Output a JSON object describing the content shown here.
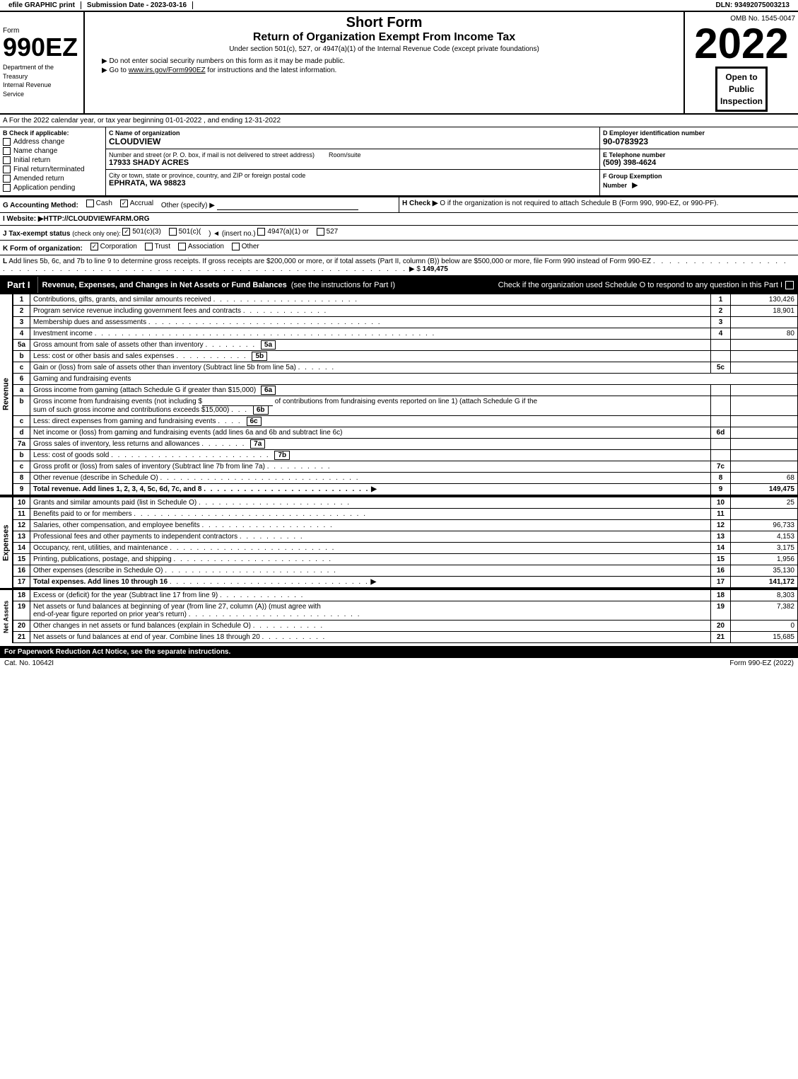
{
  "topbar": {
    "efile": "efile GRAPHIC print",
    "submission": "Submission Date - 2023-03-16",
    "dln": "DLN: 93492075003213"
  },
  "header": {
    "form_id": "990EZ",
    "form_label": "Form",
    "dept1": "Department of the",
    "dept2": "Treasury",
    "dept3": "Internal Revenue",
    "dept4": "Service",
    "title1": "Short Form",
    "title2": "Return of Organization Exempt From Income Tax",
    "subtitle": "Under section 501(c), 527, or 4947(a)(1) of the Internal Revenue Code (except private foundations)",
    "notice1": "▶ Do not enter social security numbers on this form as it may be made public.",
    "notice2": "▶ Go to ",
    "irs_url": "www.irs.gov/Form990EZ",
    "notice2b": " for instructions and the latest information.",
    "omb": "OMB No. 1545-0047",
    "year": "2022",
    "open_to_public": "Open to\nPublic\nInspection"
  },
  "section_a": {
    "text": "A For the 2022 calendar year, or tax year beginning 01-01-2022 , and ending 12-31-2022"
  },
  "section_b": {
    "label": "B Check if applicable:",
    "checkboxes": [
      {
        "label": "Address change",
        "checked": false
      },
      {
        "label": "Name change",
        "checked": false
      },
      {
        "label": "Initial return",
        "checked": false
      },
      {
        "label": "Final return/terminated",
        "checked": false
      },
      {
        "label": "Amended return",
        "checked": false
      },
      {
        "label": "Application pending",
        "checked": false
      }
    ]
  },
  "section_c": {
    "label": "C Name of organization",
    "name": "CLOUDVIEW",
    "street_label": "Number and street (or P. O. box, if mail is not delivered to street address)",
    "street": "17933 SHADY ACRES",
    "room_label": "Room/suite",
    "room": "",
    "city_label": "City or town, state or province, country, and ZIP or foreign postal code",
    "city": "EPHRATA, WA  98823"
  },
  "section_d": {
    "label": "D Employer identification number",
    "ein": "90-0783923"
  },
  "section_e": {
    "label": "E Telephone number",
    "phone": "(509) 398-4624"
  },
  "section_f": {
    "label": "F Group Exemption",
    "label2": "Number",
    "value": ""
  },
  "section_g": {
    "label": "G Accounting Method:",
    "cash": "Cash",
    "accrual": "Accrual",
    "accrual_checked": true,
    "other": "Other (specify) ▶"
  },
  "section_h": {
    "label": "H Check ▶",
    "text": " O if the organization is not required to attach Schedule B (Form 990, 990-EZ, or 990-PF)."
  },
  "section_i": {
    "label": "I Website: ▶HTTP://CLOUDVIEWFARM.ORG"
  },
  "section_j": {
    "label": "J Tax-exempt status",
    "note": "(check only one):",
    "options": [
      {
        "label": "501(c)(3)",
        "checked": true
      },
      {
        "label": "501(c)(",
        "checked": false
      },
      {
        "label": ") ◄ (insert no.)",
        "checked": false
      },
      {
        "label": "4947(a)(1) or",
        "checked": false
      },
      {
        "label": "527",
        "checked": false
      }
    ]
  },
  "section_k": {
    "label": "K Form of organization:",
    "options": [
      {
        "label": "Corporation",
        "checked": true
      },
      {
        "label": "Trust",
        "checked": false
      },
      {
        "label": "Association",
        "checked": false
      },
      {
        "label": "Other",
        "checked": false
      }
    ]
  },
  "section_l": {
    "text": "L Add lines 5b, 6c, and 7b to line 9 to determine gross receipts. If gross receipts are $200,000 or more, or if total assets (Part II, column (B)) below are $500,000 or more, file Form 990 instead of Form 990-EZ",
    "dots": ".",
    "arrow": "▶ $",
    "value": "149,475"
  },
  "part1": {
    "label": "Part I",
    "title": "Revenue, Expenses, and Changes in Net Assets or Fund Balances",
    "subtitle": "(see the instructions for Part I)",
    "check_note": "Check if the organization used Schedule O to respond to any question in this Part I",
    "rows": [
      {
        "num": "1",
        "description": "Contributions, gifts, grants, and similar amounts received",
        "line_ref": "1",
        "amount": "130,426"
      },
      {
        "num": "2",
        "description": "Program service revenue including government fees and contracts",
        "line_ref": "2",
        "amount": "18,901"
      },
      {
        "num": "3",
        "description": "Membership dues and assessments",
        "line_ref": "3",
        "amount": ""
      },
      {
        "num": "4",
        "description": "Investment income",
        "line_ref": "4",
        "amount": "80"
      },
      {
        "num": "5a",
        "description": "Gross amount from sale of assets other than inventory",
        "line_ref": "5a",
        "amount": ""
      },
      {
        "num": "5b",
        "description": "Less: cost or other basis and sales expenses",
        "line_ref": "5b",
        "amount": ""
      },
      {
        "num": "5c",
        "description": "Gain or (loss) from sale of assets other than inventory (Subtract line 5b from line 5a)",
        "line_ref": "5c",
        "amount": ""
      },
      {
        "num": "6",
        "description": "Gaming and fundraising events",
        "line_ref": "",
        "amount": ""
      },
      {
        "num": "6a",
        "description": "Gross income from gaming (attach Schedule G if greater than $15,000)",
        "line_ref": "6a",
        "amount": ""
      },
      {
        "num": "6b",
        "description": "Gross income from fundraising events (not including $___________of contributions from fundraising events reported on line 1) (attach Schedule G if the sum of such gross income and contributions exceeds $15,000)",
        "line_ref": "6b",
        "amount": ""
      },
      {
        "num": "6c",
        "description": "Less: direct expenses from gaming and fundraising events",
        "line_ref": "6c",
        "amount": ""
      },
      {
        "num": "6d",
        "description": "Net income or (loss) from gaming and fundraising events (add lines 6a and 6b and subtract line 6c)",
        "line_ref": "6d",
        "amount": ""
      },
      {
        "num": "7a",
        "description": "Gross sales of inventory, less returns and allowances",
        "line_ref": "7a",
        "amount": ""
      },
      {
        "num": "7b",
        "description": "Less: cost of goods sold",
        "line_ref": "7b",
        "amount": ""
      },
      {
        "num": "7c",
        "description": "Gross profit or (loss) from sales of inventory (Subtract line 7b from line 7a)",
        "line_ref": "7c",
        "amount": ""
      },
      {
        "num": "8",
        "description": "Other revenue (describe in Schedule O)",
        "line_ref": "8",
        "amount": "68"
      },
      {
        "num": "9",
        "description": "Total revenue. Add lines 1, 2, 3, 4, 5c, 6d, 7c, and 8",
        "line_ref": "9",
        "amount": "149,475",
        "bold": true
      }
    ]
  },
  "part1_expenses": {
    "rows": [
      {
        "num": "10",
        "description": "Grants and similar amounts paid (list in Schedule O)",
        "line_ref": "10",
        "amount": "25"
      },
      {
        "num": "11",
        "description": "Benefits paid to or for members",
        "line_ref": "11",
        "amount": ""
      },
      {
        "num": "12",
        "description": "Salaries, other compensation, and employee benefits",
        "line_ref": "12",
        "amount": "96,733"
      },
      {
        "num": "13",
        "description": "Professional fees and other payments to independent contractors",
        "line_ref": "13",
        "amount": "4,153"
      },
      {
        "num": "14",
        "description": "Occupancy, rent, utilities, and maintenance",
        "line_ref": "14",
        "amount": "3,175"
      },
      {
        "num": "15",
        "description": "Printing, publications, postage, and shipping",
        "line_ref": "15",
        "amount": "1,956"
      },
      {
        "num": "16",
        "description": "Other expenses (describe in Schedule O)",
        "line_ref": "16",
        "amount": "35,130"
      },
      {
        "num": "17",
        "description": "Total expenses. Add lines 10 through 16",
        "line_ref": "17",
        "amount": "141,172",
        "bold": true
      }
    ]
  },
  "part1_netassets": {
    "rows": [
      {
        "num": "18",
        "description": "Excess or (deficit) for the year (Subtract line 17 from line 9)",
        "line_ref": "18",
        "amount": "8,303"
      },
      {
        "num": "19",
        "description": "Net assets or fund balances at beginning of year (from line 27, column (A)) (must agree with end-of-year figure reported on prior year's return)",
        "line_ref": "19",
        "amount": "7,382"
      },
      {
        "num": "20",
        "description": "Other changes in net assets or fund balances (explain in Schedule O)",
        "line_ref": "20",
        "amount": "0"
      },
      {
        "num": "21",
        "description": "Net assets or fund balances at end of year. Combine lines 18 through 20",
        "line_ref": "21",
        "amount": "15,685"
      }
    ]
  },
  "footer": {
    "paperwork": "For Paperwork Reduction Act Notice, see the separate instructions.",
    "cat_no": "Cat. No. 10642I",
    "form_ref": "Form 990-EZ (2022)"
  }
}
